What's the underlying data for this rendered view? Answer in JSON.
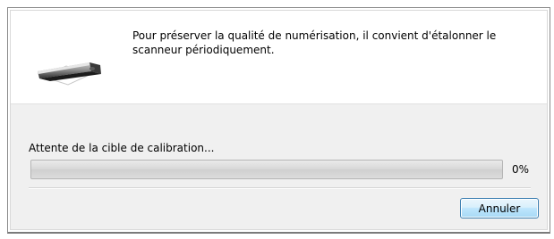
{
  "message": "Pour préserver la qualité de numérisation, il convient d'étalonner le scanneur périodiquement.",
  "status": "Attente de la cible de calibration...",
  "progress": {
    "value": 0,
    "label": "0%"
  },
  "buttons": {
    "cancel_label": "Annuler"
  },
  "icons": {
    "scanner": "scanner-icon"
  },
  "colors": {
    "progress_track": "#d8d8d8",
    "button_border": "#3c7fb1",
    "button_face": "#bee6fd",
    "lower_panel": "#f0f0f0"
  }
}
